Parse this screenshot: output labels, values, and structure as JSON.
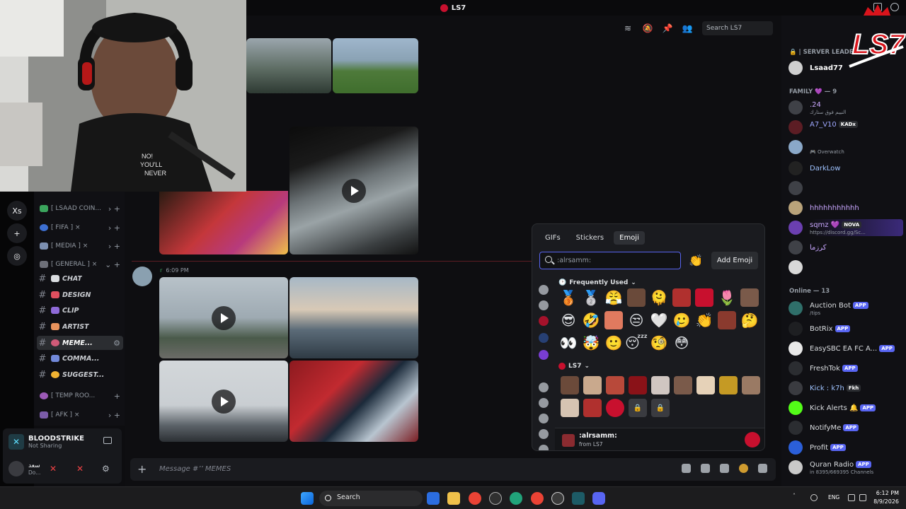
{
  "window": {
    "title": "LS7"
  },
  "rail": {
    "xs_label": "Xs"
  },
  "channels": [
    {
      "name": "[ LSAAD COIN...",
      "kind": "category-ish"
    },
    {
      "name": "[ FIFA ] ×"
    },
    {
      "name": "[ MEDIA ] ×"
    },
    {
      "name": "[ GENERAL ] ×"
    },
    {
      "name": "CHAT"
    },
    {
      "name": "DESIGN"
    },
    {
      "name": "CLIP"
    },
    {
      "name": "ARTIST"
    },
    {
      "name": "MEME..."
    },
    {
      "name": "COMMA..."
    },
    {
      "name": "SUGGEST..."
    },
    {
      "name": "[ TEMP ROO..."
    },
    {
      "name": "[ AFK ] ×"
    }
  ],
  "user_panel": {
    "game": "BLOODSTRIKE",
    "game_status": "Not Sharing",
    "user_name": "سعد",
    "user_sub": "Do..."
  },
  "header": {
    "search_placeholder": "Search LS7"
  },
  "message": {
    "time": "6:09 PM",
    "prefix": "r"
  },
  "composer": {
    "placeholder": "Message #’’ MEMES"
  },
  "picker": {
    "tabs": [
      "GIFs",
      "Stickers",
      "Emoji"
    ],
    "active_tab": "Emoji",
    "search_value": ":alrsamm:",
    "add_emoji_label": "Add Emoji",
    "section_frequent": "Frequently Used",
    "section_server": "LS7",
    "footer_name": ":alrsamm:",
    "footer_from": "from LS7",
    "frequent_emoji": [
      "🥉",
      "🥈",
      "😤",
      "",
      "🫠",
      "",
      "",
      "🌷",
      "",
      "😎",
      "🤣",
      "",
      "😒",
      "🤍",
      "🥲",
      "👏",
      "",
      "🤔",
      "👀",
      "🤯",
      "🙂",
      "😴",
      "🧐",
      "😳"
    ]
  },
  "members": {
    "server_leader_label": "| SERVER LEADER",
    "leader": "Lsaad77",
    "family_label": "FAMILY 💜 — 9",
    "family": [
      {
        "name": ".24",
        "status": "النييم فوق ستارك"
      },
      {
        "name": "A7_V10",
        "tag": "KADx"
      },
      {
        "name": "",
        "status": "Overwatch"
      },
      {
        "name": "DarkLow"
      },
      {
        "name": ""
      },
      {
        "name": "hhhhhhhhhhh"
      },
      {
        "name": "sqmz 💜",
        "tag": "NOVA",
        "status": "https://discord.gg/Sc..."
      },
      {
        "name": "كرزما"
      },
      {
        "name": ""
      }
    ],
    "online_label": "Online — 13",
    "online": [
      {
        "name": "Auction Bot",
        "badge": "APP",
        "status": "/tips"
      },
      {
        "name": "BotRix",
        "badge": "APP"
      },
      {
        "name": "EasySBC EA FC A...",
        "badge": "APP"
      },
      {
        "name": "FreshTok",
        "badge": "APP"
      },
      {
        "name": "Kick : k7h",
        "tag": "Fkh"
      },
      {
        "name": "Kick Alerts 🔔",
        "badge": "APP"
      },
      {
        "name": "NotifyMe",
        "badge": "APP"
      },
      {
        "name": "Profit",
        "badge": "APP"
      },
      {
        "name": "Quran Radio",
        "badge": "APP",
        "status": "in 8395/669395 Channels"
      }
    ]
  },
  "taskbar": {
    "search_label": "Search",
    "lang": "ENG",
    "time": "6:12 PM",
    "date": "8/9/2026"
  },
  "colors": {
    "accent": "#5865f2",
    "brand_red": "#c8102e",
    "app_badge": "#5865f2"
  }
}
